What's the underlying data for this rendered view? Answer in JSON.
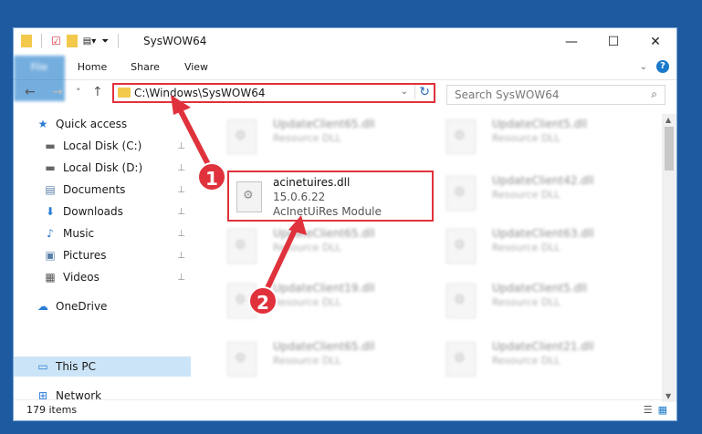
{
  "window": {
    "title": "SysWOW64",
    "controls": {
      "minimize": "—",
      "maximize": "☐",
      "close": "✕"
    }
  },
  "ribbon": {
    "tabs": [
      "File",
      "Home",
      "Share",
      "View"
    ],
    "expand_icon": "chevron-down-icon",
    "help_label": "?"
  },
  "navigation": {
    "back": "←",
    "forward": "→",
    "recent": "˅",
    "up": "↑"
  },
  "address": {
    "path": "C:\\Windows\\SysWOW64",
    "refresh": "↻",
    "dropdown": "⌄"
  },
  "search": {
    "placeholder": "Search SysWOW64",
    "icon": "⌕"
  },
  "sidebar": {
    "items": [
      {
        "label": "Quick access",
        "icon": "star-icon",
        "glyph": "★",
        "pinned": false
      },
      {
        "label": "Local Disk (C:)",
        "icon": "drive-icon",
        "glyph": "▬",
        "pinned": true
      },
      {
        "label": "Local Disk (D:)",
        "icon": "drive-icon",
        "glyph": "▬",
        "pinned": true
      },
      {
        "label": "Documents",
        "icon": "documents-icon",
        "glyph": "▤",
        "pinned": true
      },
      {
        "label": "Downloads",
        "icon": "downloads-icon",
        "glyph": "⬇",
        "pinned": true
      },
      {
        "label": "Music",
        "icon": "music-icon",
        "glyph": "♪",
        "pinned": true
      },
      {
        "label": "Pictures",
        "icon": "pictures-icon",
        "glyph": "▣",
        "pinned": true
      },
      {
        "label": "Videos",
        "icon": "videos-icon",
        "glyph": "▦",
        "pinned": true
      },
      {
        "label": "OneDrive",
        "icon": "cloud-icon",
        "glyph": "☁",
        "pinned": false
      },
      {
        "label": "This PC",
        "icon": "computer-icon",
        "glyph": "▭",
        "pinned": false
      },
      {
        "label": "Network",
        "icon": "network-icon",
        "glyph": "⊞",
        "pinned": false
      }
    ],
    "pin_glyph": "📌"
  },
  "files": {
    "left_column": [
      {
        "name": "UpdateClient65.dll",
        "desc": "Resource DLL"
      },
      {
        "name": "UpdateClient65.dll",
        "desc": "Resource DLL"
      },
      {
        "name": "UpdateClient19.dll",
        "desc": "Resource DLL"
      },
      {
        "name": "UpdateClient65.dll",
        "desc": "Resource DLL"
      }
    ],
    "right_column": [
      {
        "name": "UpdateClient5.dll",
        "desc": "Resource DLL"
      },
      {
        "name": "UpdateClient42.dll",
        "desc": "Resource DLL"
      },
      {
        "name": "UpdateClient63.dll",
        "desc": "Resource DLL"
      },
      {
        "name": "UpdateClient5.dll",
        "desc": "Resource DLL"
      },
      {
        "name": "UpdateClient21.dll",
        "desc": "Resource DLL"
      }
    ],
    "highlighted": {
      "name": "acinetuires.dll",
      "version": "15.0.6.22",
      "desc": "AcInetUiRes Module"
    }
  },
  "status": {
    "item_count": "179 items"
  },
  "markers": [
    "1",
    "2"
  ],
  "colors": {
    "accent": "#1979ca",
    "highlight_border": "#e0323c",
    "selected_bg": "#cce4f7"
  }
}
